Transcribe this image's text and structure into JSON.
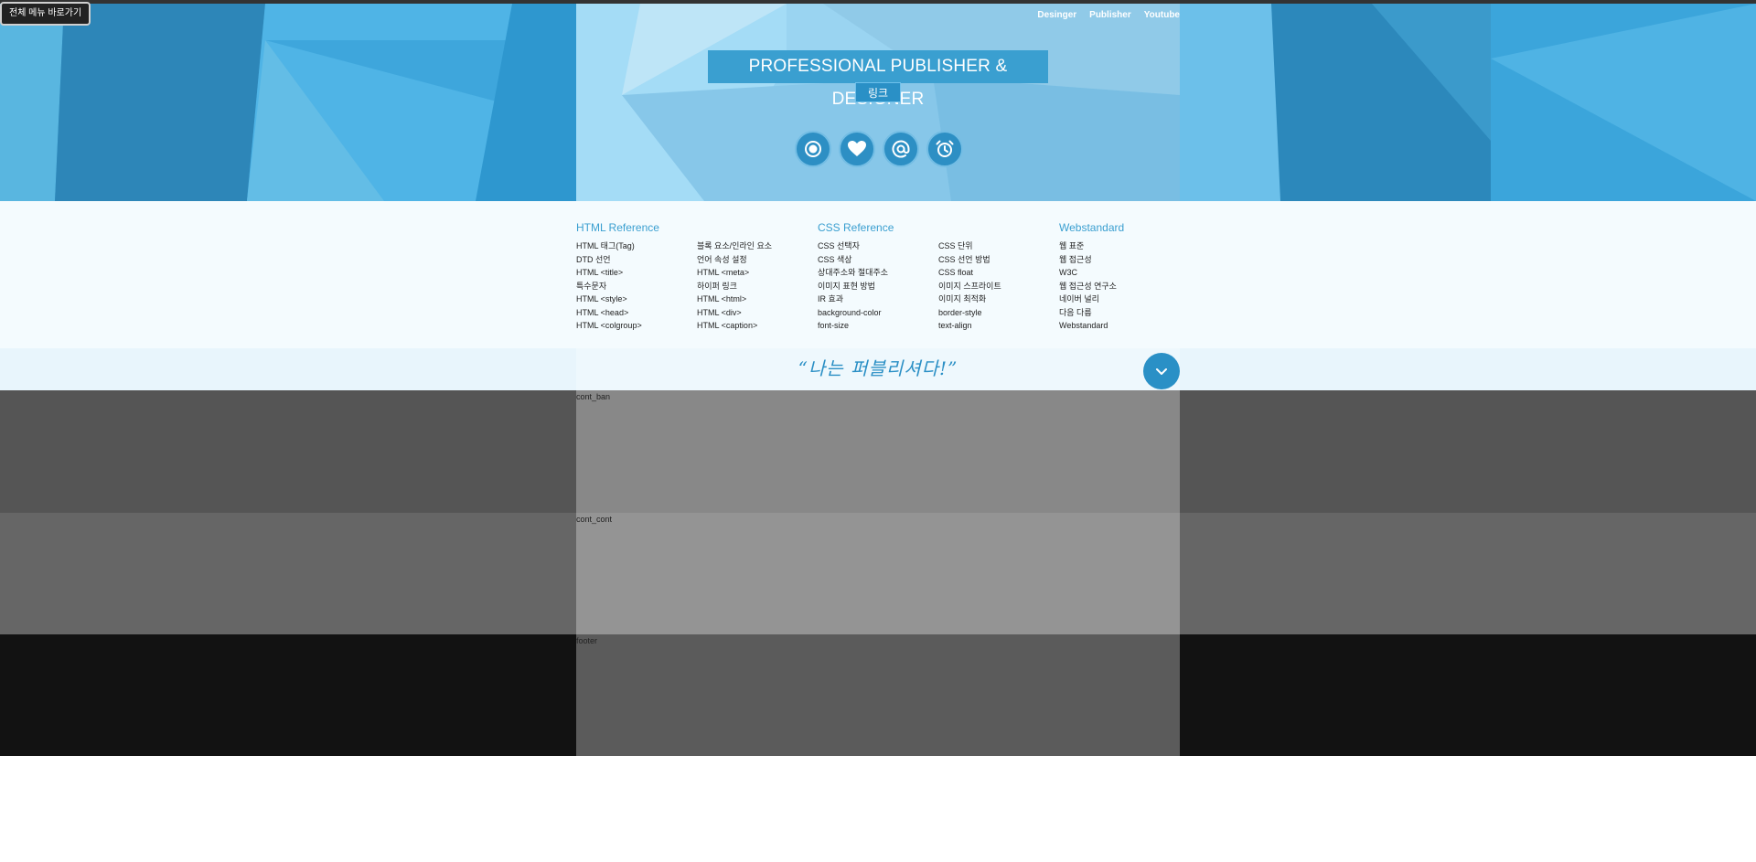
{
  "skip_link": "전체 메뉴 바로가기",
  "header": {
    "nav": [
      "Desinger",
      "Publisher",
      "Youtube"
    ],
    "title": "PROFESSIONAL PUBLISHER & DESIGNER",
    "link_label": "링크",
    "icons": [
      "record-icon",
      "heart-icon",
      "at-icon",
      "alarm-clock-icon"
    ]
  },
  "links": {
    "columns": [
      {
        "heading": "HTML Reference",
        "items": [
          "HTML 태그(Tag)",
          "DTD 선언",
          "HTML <title>",
          "특수문자",
          "HTML <style>",
          "HTML <head>",
          "HTML <colgroup>"
        ]
      },
      {
        "heading": "",
        "items": [
          "블록 요소/인라인 요소",
          "언어 속성 설정",
          "HTML <meta>",
          "하이퍼 링크",
          "HTML <html>",
          "HTML <div>",
          "HTML <caption>"
        ]
      },
      {
        "heading": "CSS Reference",
        "items": [
          "CSS 선택자",
          "CSS 색상",
          "상대주소와 절대주소",
          "이미지 표현 방법",
          "IR 효과",
          "background-color",
          "font-size"
        ]
      },
      {
        "heading": "",
        "items": [
          "CSS 단위",
          "CSS 선언 방법",
          "CSS float",
          "이미지 스프라이트",
          "이미지 최적화",
          "border-style",
          "text-align"
        ]
      },
      {
        "heading": "Webstandard",
        "items": [
          "웹 표준",
          "웹 접근성",
          "W3C",
          "웹 접근성 연구소",
          "네이버 널리",
          "다음 다름",
          "Webstandard"
        ]
      }
    ]
  },
  "slogan": "“나는 퍼블리셔다!”",
  "sections": {
    "ban": "cont_ban",
    "cont": "cont_cont",
    "footer": "footer"
  },
  "colors": {
    "accent": "#2a90c6",
    "header_bg": "#2f9bd0",
    "link_heading": "#3a9fd0"
  }
}
